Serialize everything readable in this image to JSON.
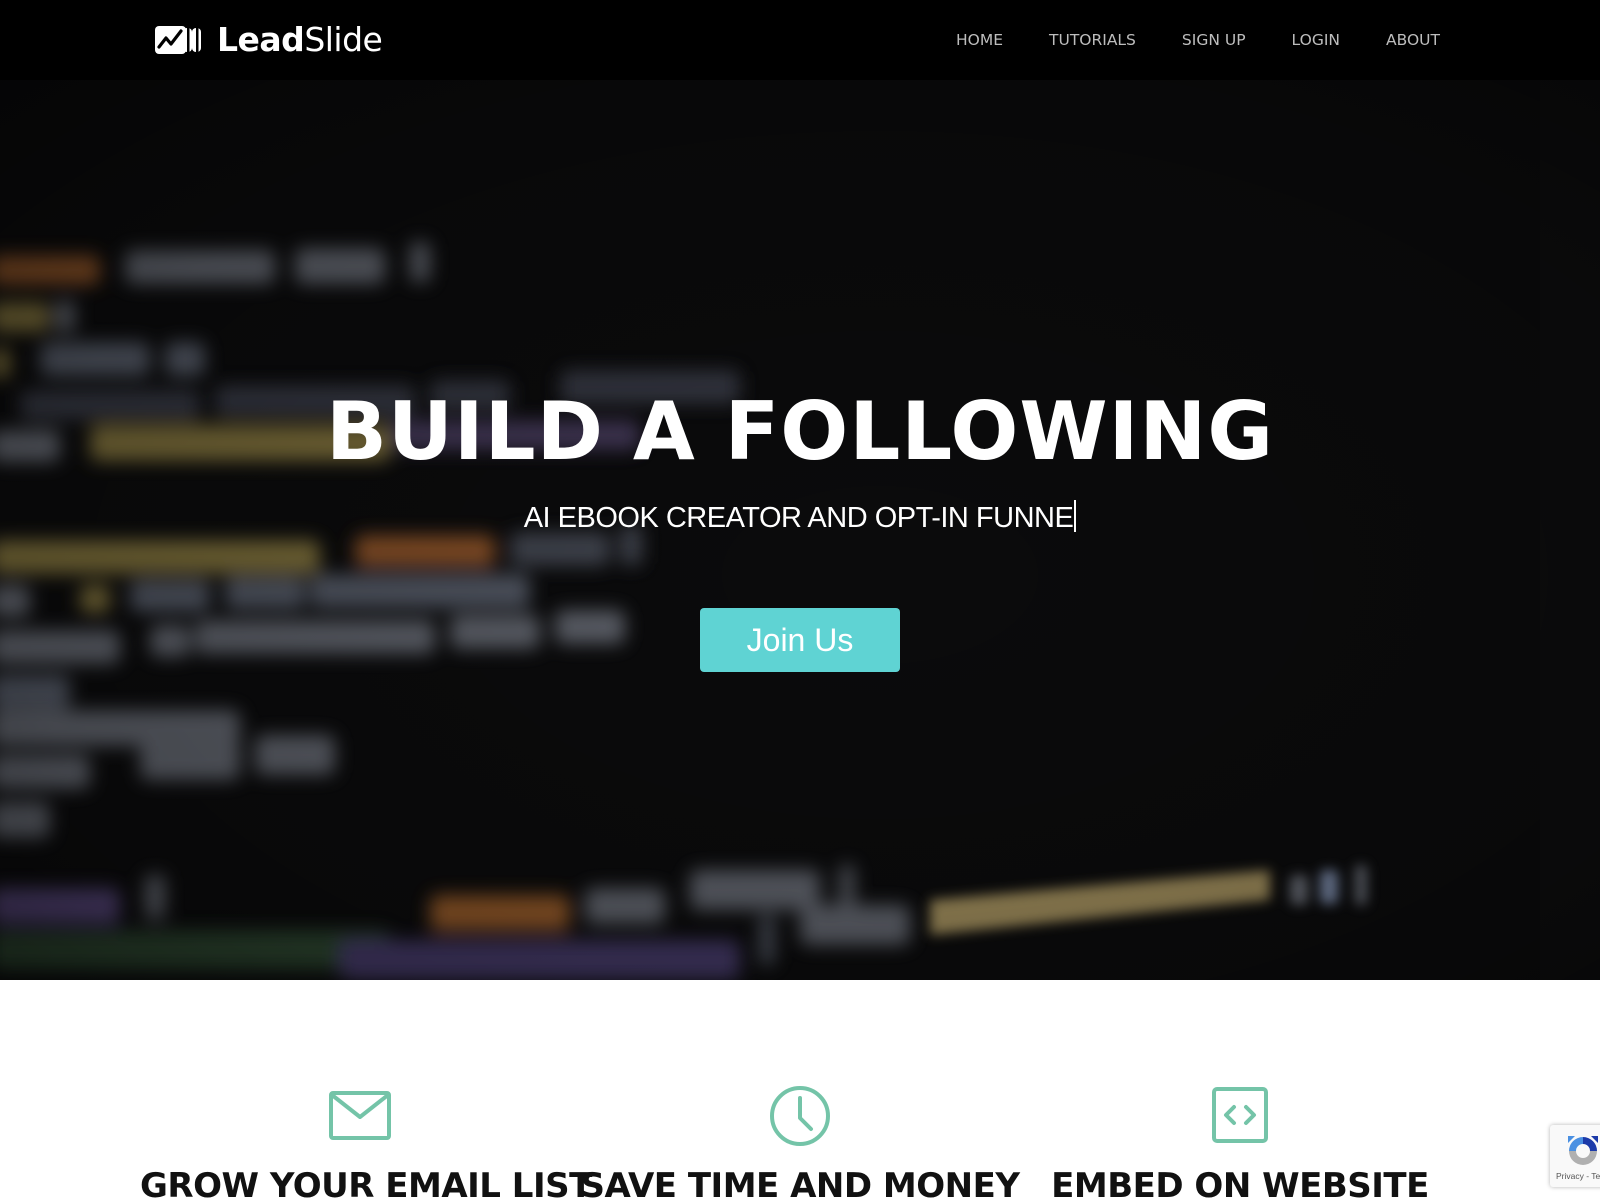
{
  "nav": {
    "logo": {
      "bold": "Lead",
      "light": "Slide",
      "icon": "logo-slides-chart-icon"
    },
    "links": [
      {
        "label": "HOME"
      },
      {
        "label": "TUTORIALS"
      },
      {
        "label": "SIGN UP"
      },
      {
        "label": "LOGIN"
      },
      {
        "label": "ABOUT"
      }
    ]
  },
  "hero": {
    "title": "BUILD A FOLLOWING",
    "subtitle": "AI EBOOK CREATOR AND OPT-IN FUNNE",
    "cta_label": "Join Us",
    "background": "blurred-code-editor-photo"
  },
  "features": [
    {
      "icon": "envelope-icon",
      "title": "GROW YOUR EMAIL LIST"
    },
    {
      "icon": "clock-icon",
      "title": "SAVE TIME AND MONEY"
    },
    {
      "icon": "code-embed-icon",
      "title": "EMBED ON WEBSITE"
    }
  ],
  "recaptcha": {
    "links": "Privacy - Terms"
  },
  "colors": {
    "nav_bg": "#000000",
    "nav_link": "#bdbdbd",
    "accent_button": "#5fd3d3",
    "feature_icon": "#74c4a8",
    "feature_title": "#111111"
  }
}
